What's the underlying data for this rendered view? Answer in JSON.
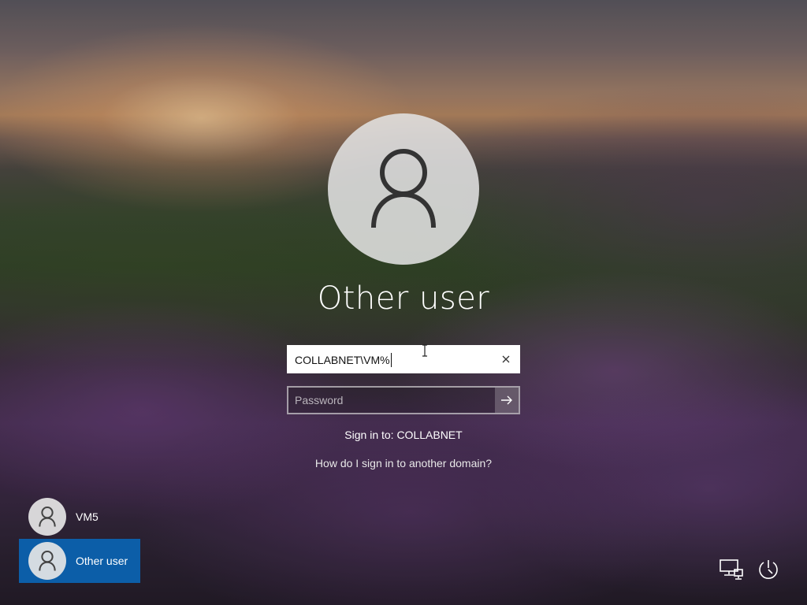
{
  "login": {
    "display_name": "Other user",
    "username_value": "COLLABNET\\VM%",
    "password_placeholder": "Password",
    "sign_in_to": "Sign in to: COLLABNET",
    "domain_help_link": "How do I sign in to another domain?"
  },
  "user_list": [
    {
      "label": "VM5",
      "selected": false
    },
    {
      "label": "Other user",
      "selected": true
    }
  ],
  "icons": {
    "avatar": "person-icon",
    "clear": "close-icon",
    "submit": "arrow-right-icon",
    "network": "network-icon",
    "power": "power-icon"
  },
  "colors": {
    "selected_tile": "#0c5ea8"
  }
}
